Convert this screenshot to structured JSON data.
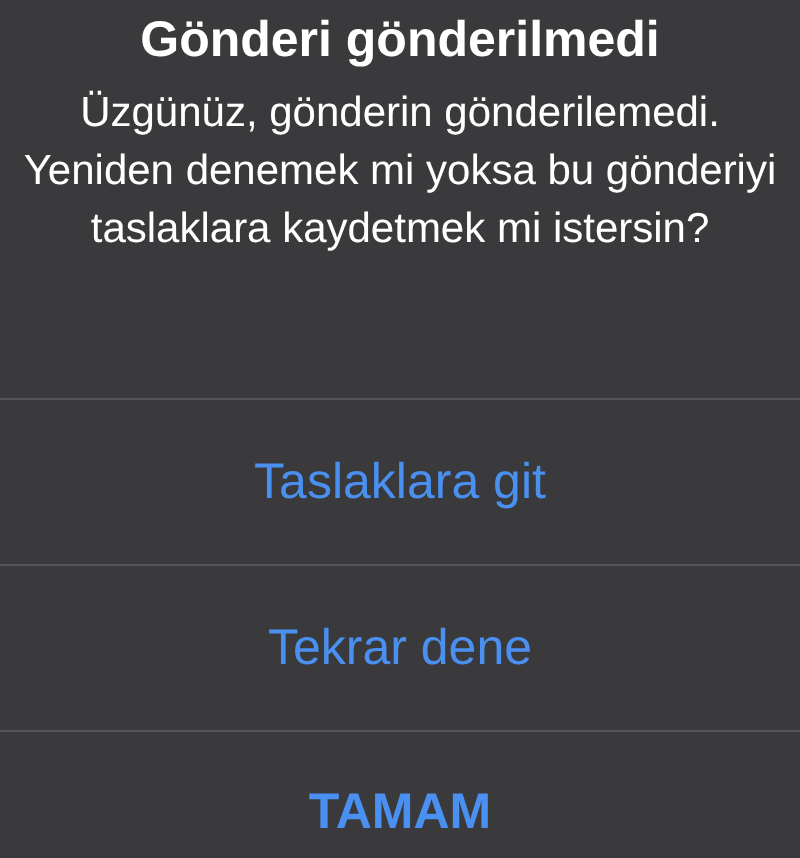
{
  "alert": {
    "title": "Gönderi gönderilmedi",
    "message": "Üzgünüz, gönderin gönderilemedi. Yeniden denemek mi yoksa bu gönderiyi taslaklara kaydetmek mi istersin?"
  },
  "actions": [
    {
      "label": "Taslaklara git",
      "kind": "default"
    },
    {
      "label": "Tekrar dene",
      "kind": "default"
    },
    {
      "label": "TAMAM",
      "kind": "preferred"
    }
  ]
}
